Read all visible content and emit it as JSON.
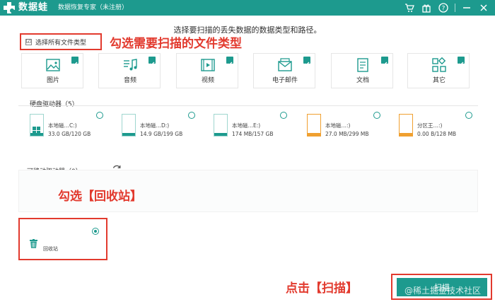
{
  "titlebar": {
    "app_name": "数据蛙",
    "subtitle": "数据恢复专家（未注册）",
    "icons": [
      "cart-icon",
      "gift-icon",
      "help-icon",
      "minimize-icon",
      "close-icon"
    ]
  },
  "prompt": "选择要扫描的丢失数据的数据类型和路径。",
  "select_all": {
    "checked": "☑",
    "label": "选择所有文件类型"
  },
  "annotations": {
    "select_types": "勾选需要扫描的文件类型",
    "recycle": "勾选【回收站】",
    "scan": "点击【扫描】"
  },
  "file_types": [
    {
      "label": "图片",
      "icon": "image-icon"
    },
    {
      "label": "音频",
      "icon": "music-icon"
    },
    {
      "label": "视频",
      "icon": "video-icon"
    },
    {
      "label": "电子邮件",
      "icon": "email-icon"
    },
    {
      "label": "文档",
      "icon": "document-icon"
    },
    {
      "label": "其它",
      "icon": "other-icon"
    }
  ],
  "hard_drives": {
    "title": "硬盘驱动器（5）",
    "drives": [
      {
        "name": "本地磁…C:)",
        "size": "33.0 GB/120 GB",
        "fill_fraction": 0.275,
        "bar_color": "#1d9a8e",
        "system": true
      },
      {
        "name": "本地磁…D:)",
        "size": "14.9 GB/199 GB",
        "fill_fraction": 0.075,
        "bar_color": "#1d9a8e",
        "system": false
      },
      {
        "name": "本地磁…E:)",
        "size": "174 MB/157 GB",
        "fill_fraction": 0.01,
        "bar_color": "#1d9a8e",
        "system": false
      },
      {
        "name": "本地磁…:)",
        "size": "27.0 MB/299 MB",
        "fill_fraction": 0.09,
        "bar_color": "#f0a030",
        "system": false
      },
      {
        "name": "分区王…:)",
        "size": "0.00  B/128 MB",
        "fill_fraction": 0.0,
        "bar_color": "#f0a030",
        "system": false
      }
    ]
  },
  "removable": {
    "title": "可移动驱动器（0）",
    "refresh_icon": "refresh-icon"
  },
  "recycle_bin": {
    "label": "回收站",
    "icon": "trash-icon",
    "selected": true
  },
  "scan_button": {
    "label": "扫描"
  },
  "watermark": "@稀土掘金技术社区",
  "colors": {
    "accent": "#1d9a8e",
    "annotation": "#e23a2e",
    "warning": "#f0a030"
  }
}
